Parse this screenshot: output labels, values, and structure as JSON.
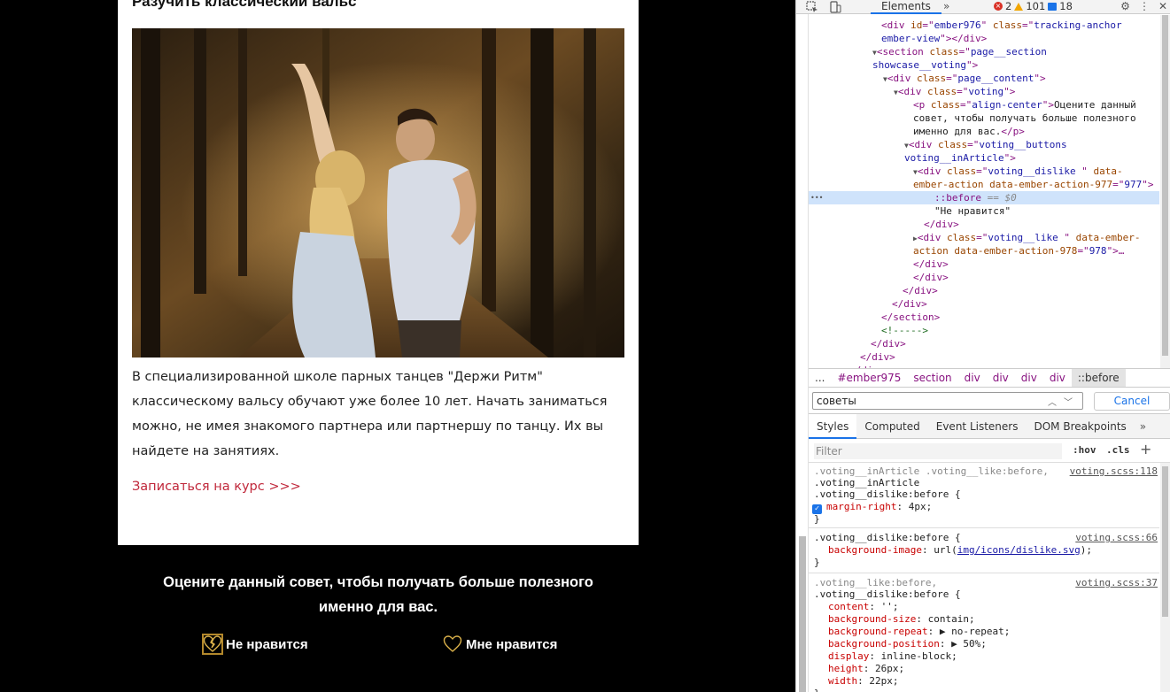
{
  "article": {
    "title": "Разучить классический вальс",
    "body": "В специализированной школе парных танцев \"Держи Ритм\" классическому вальсу обучают уже более 10 лет. Начать заниматься можно, не имея знакомого партнера или партнершу по танцу. Их вы найдете на занятиях.",
    "link_label": "Записаться на курс >>>"
  },
  "voting": {
    "prompt_line1": "Оцените данный совет, чтобы получать больше полезного",
    "prompt_line2": "именно для вас.",
    "dislike_label": "Не нравится",
    "like_label": "Мне нравится"
  },
  "devtools": {
    "tab_elements": "Elements",
    "errors": "2",
    "warnings": "101",
    "info": "18",
    "dom": [
      {
        "indent": 86,
        "html": "<span class='tag'>&lt;div </span><span class='attr'>id</span><span class='tag'>=\"</span><span class='val'>ember976</span><span class='tag'>\" </span><span class='attr'>class</span><span class='tag'>=\"</span><span class='val'>tracking-anchor</span>"
      },
      {
        "indent": 86,
        "html": "<span class='val'>ember-view</span><span class='tag'>\"&gt;&lt;/div&gt;</span>"
      },
      {
        "indent": 76,
        "html": "<span class='tri'>▼</span><span class='tag'>&lt;section </span><span class='attr'>class</span><span class='tag'>=\"</span><span class='val'>page__section</span>"
      },
      {
        "indent": 76,
        "html": "<span class='val'>showcase__voting</span><span class='tag'>\"&gt;</span>"
      },
      {
        "indent": 88,
        "html": "<span class='tri'>▼</span><span class='tag'>&lt;div </span><span class='attr'>class</span><span class='tag'>=\"</span><span class='val'>page__content</span><span class='tag'>\"&gt;</span>"
      },
      {
        "indent": 100,
        "html": "<span class='tri'>▼</span><span class='tag'>&lt;div </span><span class='attr'>class</span><span class='tag'>=\"</span><span class='val'>voting</span><span class='tag'>\"&gt;</span>"
      },
      {
        "indent": 122,
        "html": "<span class='tag'>&lt;p </span><span class='attr'>class</span><span class='tag'>=\"</span><span class='val'>align-center</span><span class='tag'>\"&gt;</span><span class='txt'>Оцените данный</span>"
      },
      {
        "indent": 122,
        "html": "<span class='txt'>совет, чтобы получать больше полезного</span>"
      },
      {
        "indent": 122,
        "html": "<span class='txt'>именно для вас.</span><span class='tag'>&lt;/p&gt;</span>"
      },
      {
        "indent": 112,
        "html": "<span class='tri'>▼</span><span class='tag'>&lt;div </span><span class='attr'>class</span><span class='tag'>=\"</span><span class='val'>voting__buttons</span>"
      },
      {
        "indent": 112,
        "html": "<span class='val'>voting__inArticle</span><span class='tag'>\"&gt;</span>"
      },
      {
        "indent": 122,
        "html": "<span class='tri'>▼</span><span class='tag'>&lt;div </span><span class='attr'>class</span><span class='tag'>=\"</span><span class='val'>voting__dislike </span><span class='tag'>\" </span><span class='attr'>data-</span>"
      },
      {
        "indent": 122,
        "html": "<span class='attr'>ember-action data-ember-action-977</span><span class='tag'>=\"</span><span class='val'>977</span><span class='tag'>\"&gt;</span>"
      },
      {
        "indent": 146,
        "html": "<span class='pseudo'>::before</span> <span class='dim'>== $0</span>",
        "selected": true
      },
      {
        "indent": 146,
        "html": "<span class='txt'>\"Не нравится\"</span>"
      },
      {
        "indent": 134,
        "html": "<span class='tag'>&lt;/div&gt;</span>"
      },
      {
        "indent": 122,
        "html": "<span class='tri'>▶</span><span class='tag'>&lt;div </span><span class='attr'>class</span><span class='tag'>=\"</span><span class='val'>voting__like </span><span class='tag'>\" </span><span class='attr'>data-ember-</span>"
      },
      {
        "indent": 122,
        "html": "<span class='attr'>action data-ember-action-978</span><span class='tag'>=\"</span><span class='val'>978</span><span class='tag'>\"&gt;…</span>"
      },
      {
        "indent": 122,
        "html": "<span class='tag'>&lt;/div&gt;</span>"
      },
      {
        "indent": 122,
        "html": "<span class='tag'>&lt;/div&gt;</span>"
      },
      {
        "indent": 110,
        "html": "<span class='tag'>&lt;/div&gt;</span>"
      },
      {
        "indent": 98,
        "html": "<span class='tag'>&lt;/div&gt;</span>"
      },
      {
        "indent": 86,
        "html": "<span class='tag'>&lt;/section&gt;</span>"
      },
      {
        "indent": 86,
        "html": "<span class='cmt'>&lt;!-----&gt;</span>"
      },
      {
        "indent": 74,
        "html": "<span class='tag'>&lt;/div&gt;</span>"
      },
      {
        "indent": 62,
        "html": "<span class='tag'>&lt;/div&gt;</span>"
      },
      {
        "indent": 50,
        "html": "<span class='tag'>&lt;/div&gt;</span>"
      }
    ],
    "breadcrumb": [
      "...",
      "#ember975",
      "section",
      "div",
      "div",
      "div",
      "div",
      "::before"
    ],
    "search_value": "советы",
    "cancel_label": "Cancel",
    "subtabs": [
      "Styles",
      "Computed",
      "Event Listeners",
      "DOM Breakpoints"
    ],
    "filter_placeholder": "Filter",
    "hov": ":hov",
    "cls": ".cls",
    "rules": [
      {
        "selectors": [
          {
            "text": ".voting__inArticle .voting__like:before,",
            "grey": true
          },
          {
            "text": ".voting__inArticle",
            "grey": false
          },
          {
            "text": ".voting__dislike:before {",
            "grey": false
          }
        ],
        "source": "voting.scss:118",
        "props": [
          {
            "name": "margin-right",
            "value": "4px;",
            "checked": true
          }
        ]
      },
      {
        "selectors": [
          {
            "text": ".voting__dislike:before {",
            "grey": false
          }
        ],
        "source": "voting.scss:66",
        "props": [
          {
            "name": "background-image",
            "value": "url(",
            "link": "img/icons/dislike.svg",
            "after": ");"
          }
        ]
      },
      {
        "selectors": [
          {
            "text": ".voting__like:before,",
            "grey": true
          },
          {
            "text": ".voting__dislike:before {",
            "grey": false
          }
        ],
        "source": "voting.scss:37",
        "props": [
          {
            "name": "content",
            "value": "'';"
          },
          {
            "name": "background-size",
            "value": "contain;"
          },
          {
            "name": "background-repeat",
            "value": "▶ no-repeat;"
          },
          {
            "name": "background-position",
            "value": "▶ 50%;"
          },
          {
            "name": "display",
            "value": "inline-block;"
          },
          {
            "name": "height",
            "value": "26px;"
          },
          {
            "name": "width",
            "value": "22px;"
          }
        ]
      }
    ]
  },
  "colors": {
    "link_red": "#c0283b",
    "heart_gold": "#d9b04a",
    "devtools_blue": "#1a73e8"
  }
}
